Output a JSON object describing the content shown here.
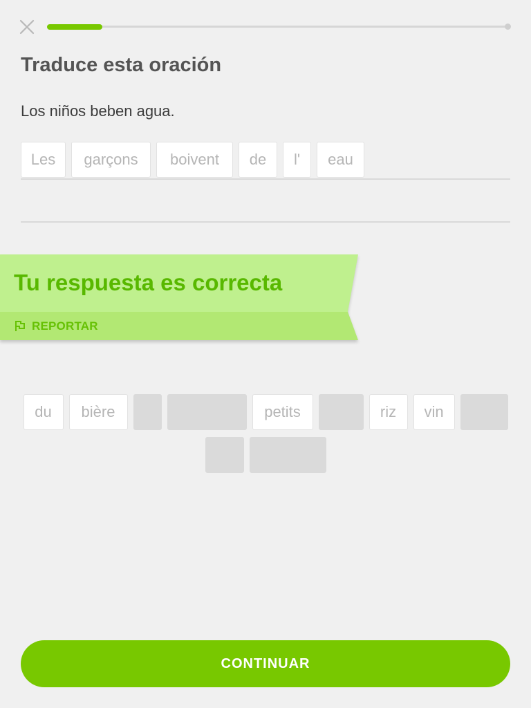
{
  "header": {
    "close_icon": "close-icon",
    "progress_fraction": 0.12
  },
  "exercise": {
    "title": "Traduce esta oración",
    "prompt": "Los niños beben agua."
  },
  "answer": {
    "tiles": [
      "Les",
      "garçons",
      "boivent",
      "de",
      "l'",
      "eau"
    ]
  },
  "feedback": {
    "message": "Tu respuesta es correcta",
    "report_label": "REPORTAR",
    "report_icon": "flag-icon",
    "colors": {
      "banner": "#bff08e",
      "banner_dark": "#b2e873",
      "text": "#58b800"
    }
  },
  "word_bank": {
    "tiles": [
      {
        "label": "du",
        "used": false
      },
      {
        "label": "bière",
        "used": false
      },
      {
        "label": "",
        "used": true
      },
      {
        "label": "",
        "used": true
      },
      {
        "label": "petits",
        "used": false
      },
      {
        "label": "",
        "used": true
      },
      {
        "label": "riz",
        "used": false
      },
      {
        "label": "vin",
        "used": false
      },
      {
        "label": "",
        "used": true
      },
      {
        "label": "",
        "used": true
      },
      {
        "label": "",
        "used": true
      }
    ]
  },
  "footer": {
    "continue_label": "CONTINUAR",
    "accent": "#78c800"
  }
}
